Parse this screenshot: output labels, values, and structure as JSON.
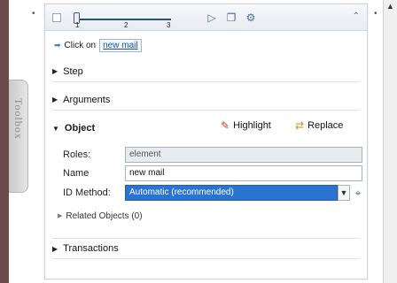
{
  "toolbox": {
    "label": "Toolbox"
  },
  "toolbar": {
    "slider_ticks": [
      "1",
      "2",
      "3"
    ],
    "collapse_icon": "double-chevron-up"
  },
  "step_text": {
    "prefix": "Click on",
    "target": "new mail"
  },
  "sections": {
    "step": "Step",
    "arguments": "Arguments",
    "object": "Object",
    "transactions": "Transactions"
  },
  "object": {
    "highlight_label": "Highlight",
    "replace_label": "Replace",
    "roles_label": "Roles:",
    "roles_value": "element",
    "name_label": "Name",
    "name_value": "new mail",
    "id_method_label": "ID Method:",
    "id_method_value": "Automatic (recommended)",
    "related_label": "Related Objects (0)"
  },
  "colors": {
    "accent": "#2a74d1",
    "left_strip": "#6b4a4a"
  }
}
